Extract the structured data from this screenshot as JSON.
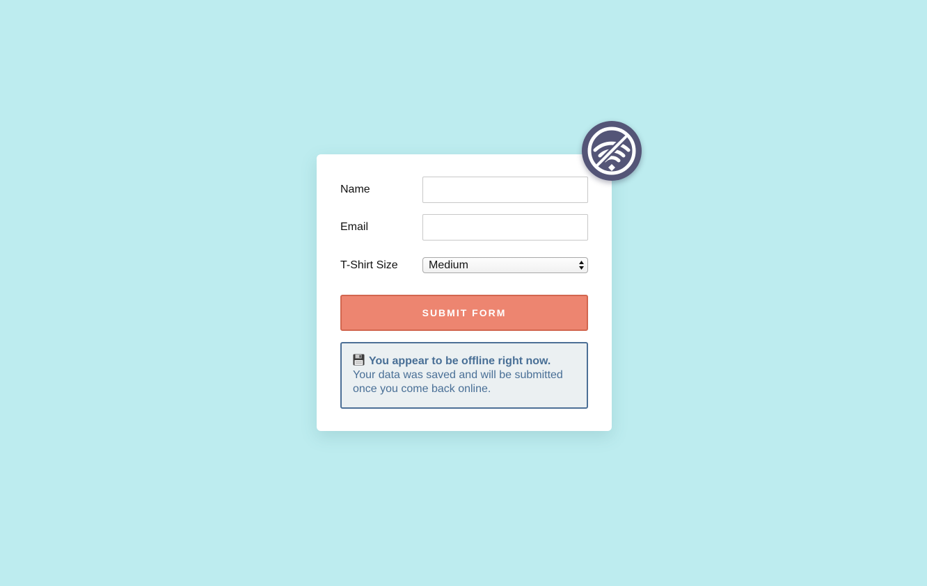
{
  "form": {
    "fields": {
      "name": {
        "label": "Name",
        "value": "",
        "placeholder": ""
      },
      "email": {
        "label": "Email",
        "value": "",
        "placeholder": ""
      },
      "tshirt_size": {
        "label": "T-Shirt Size",
        "selected": "Medium"
      }
    },
    "submit_label": "SUBMIT FORM"
  },
  "notice": {
    "icon": "floppy-disk-icon",
    "title": "You appear to be offline right now.",
    "body": "Your data was saved and will be submitted once you come back online."
  },
  "status_badge": {
    "icon": "wifi-off-icon"
  },
  "colors": {
    "background": "#bdecef",
    "submit": "#ed8570",
    "notice_text": "#496f96",
    "badge": "#545577"
  }
}
